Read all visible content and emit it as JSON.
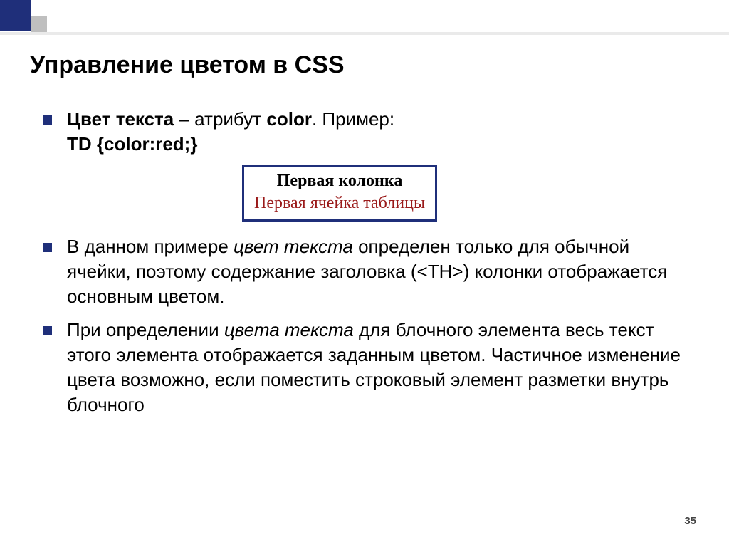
{
  "title": "Управление цветом в CSS",
  "bullet1_strong": "Цвет текста",
  "bullet1_mid": " – атрибут ",
  "bullet1_attr": "color",
  "bullet1_end": ". Пример:",
  "bullet1_code": "TD {color:red;}",
  "example_th": "Первая колонка",
  "example_td": "Первая ячейка таблицы",
  "bullet2_pre": "В данном примере ",
  "bullet2_em": "цвет текста",
  "bullet2_post": " определен только для обычной ячейки, поэтому содержание заголовка (<TH>) колонки отображается основным цветом.",
  "bullet3_pre": "При определении ",
  "bullet3_em": "цвета текста",
  "bullet3_post": " для блочного элемента весь текст этого элемента отображается заданным цветом. Частичное изменение цвета возможно, если поместить строковый элемент разметки внутрь блочного",
  "page_number": "35"
}
